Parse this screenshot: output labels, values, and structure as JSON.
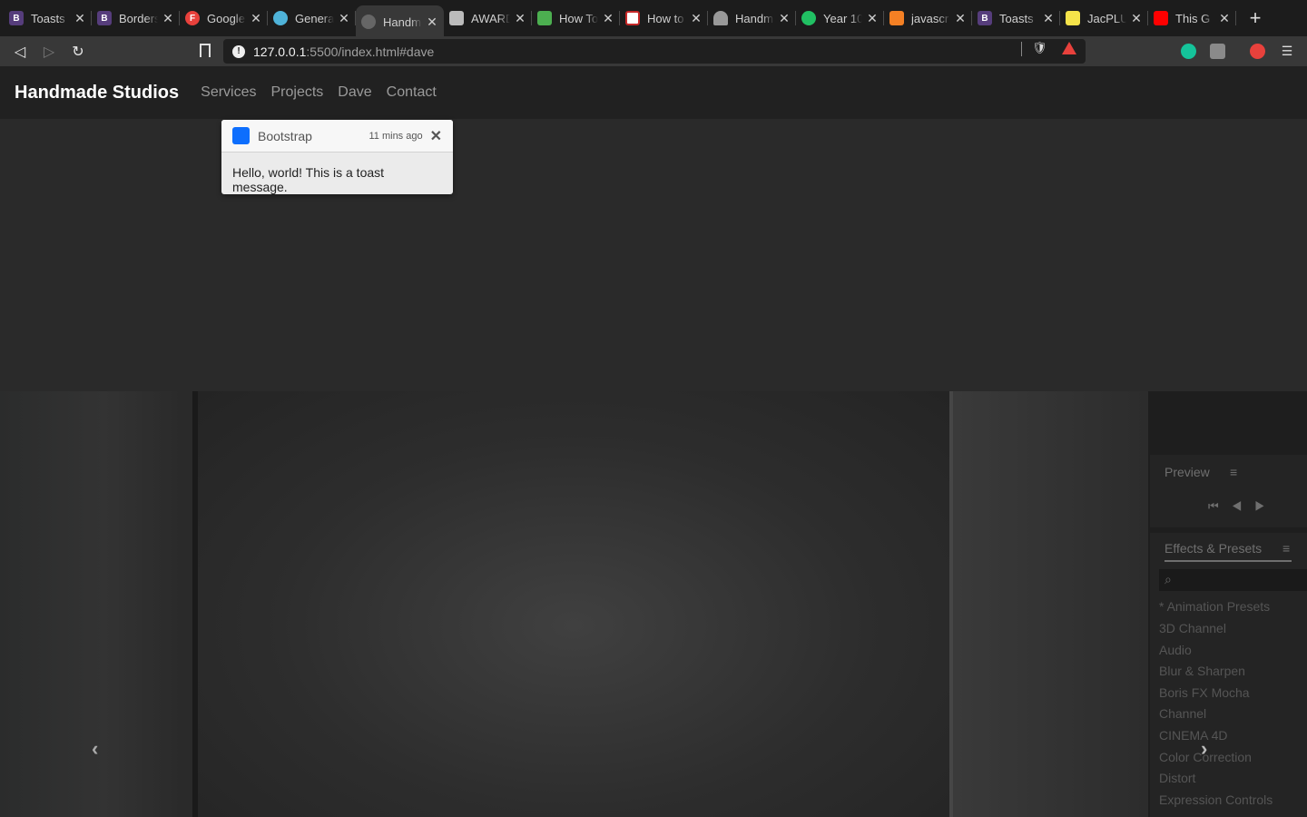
{
  "tabs": [
    {
      "favicon": "B",
      "favicon_color": "#563d7c",
      "title": "Toasts"
    },
    {
      "favicon": "B",
      "favicon_color": "#563d7c",
      "title": "Borders"
    },
    {
      "favicon": "F",
      "favicon_color": "#e8413c",
      "title": "Google"
    },
    {
      "favicon": "",
      "favicon_color": "#4fb3d9",
      "title": "Genera"
    },
    {
      "favicon": "",
      "favicon_color": "#666666",
      "title": "Handm",
      "active": true
    },
    {
      "favicon": "",
      "favicon_color": "#bbbbbb",
      "title": "AWARD"
    },
    {
      "favicon": "",
      "favicon_color": "#4caf50",
      "title": "How To"
    },
    {
      "favicon": "",
      "favicon_color": "#ffffff",
      "title": "How to"
    },
    {
      "favicon": "",
      "favicon_color": "#999999",
      "title": "Handm"
    },
    {
      "favicon": "",
      "favicon_color": "#21c063",
      "title": "Year 10"
    },
    {
      "favicon": "",
      "favicon_color": "#f48024",
      "title": "javascr"
    },
    {
      "favicon": "B",
      "favicon_color": "#563d7c",
      "title": "Toasts"
    },
    {
      "favicon": "",
      "favicon_color": "#f5e34a",
      "title": "JacPLU"
    },
    {
      "favicon": "",
      "favicon_color": "#ff0000",
      "title": "This G"
    }
  ],
  "toolbar": {
    "url_host": "127.0.0.1",
    "url_path": ":5500/index.html#dave"
  },
  "navbar": {
    "brand": "Handmade Studios",
    "links": [
      "Services",
      "Projects",
      "Dave",
      "Contact"
    ]
  },
  "toast": {
    "title": "Bootstrap",
    "time": "11 mins ago",
    "close": "✕",
    "body": "Hello, world! This is a toast message.",
    "accent": "#0d6efd"
  },
  "carousel": {
    "prev": "‹",
    "next": "›",
    "panel": {
      "preview_title": "Preview",
      "effects_title": "Effects & Presets",
      "items": [
        "* Animation Presets",
        "3D Channel",
        "Audio",
        "Blur & Sharpen",
        "Boris FX Mocha",
        "Channel",
        "CINEMA 4D",
        "Color Correction",
        "Distort",
        "Expression Controls"
      ]
    }
  }
}
